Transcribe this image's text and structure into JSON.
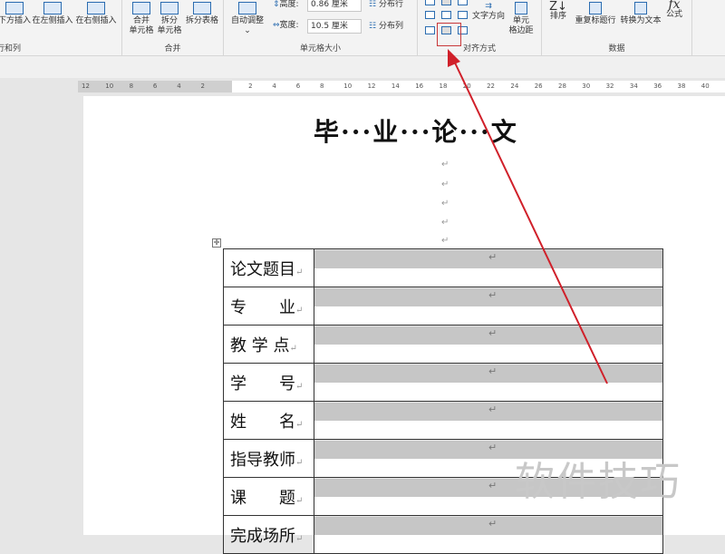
{
  "ribbon": {
    "rows_cols": {
      "buttons": [
        "下方插入",
        "在左侧插入",
        "在右侧插入"
      ],
      "label": "行和列"
    },
    "merge": {
      "buttons": [
        "合并\n单元格",
        "拆分\n单元格",
        "拆分表格"
      ],
      "label": "合并"
    },
    "cell_size": {
      "autofit": "自动调整",
      "height_label": "高度:",
      "height_value": "0.86 厘米",
      "width_label": "宽度:",
      "width_value": "10.5 厘米",
      "dist_rows": "分布行",
      "dist_cols": "分布列",
      "label": "单元格大小"
    },
    "alignment": {
      "text_direction": "文字方向",
      "cell_margins": "单元\n格边距",
      "label": "对齐方式"
    },
    "data": {
      "buttons": [
        "排序",
        "重复标题行",
        "转换为文本",
        "公式"
      ],
      "label": "数据"
    }
  },
  "ruler": [
    "12",
    "10",
    "8",
    "6",
    "4",
    "2",
    "",
    "2",
    "4",
    "6",
    "8",
    "10",
    "12",
    "14",
    "16",
    "18",
    "20",
    "22",
    "24",
    "26",
    "28",
    "30",
    "32",
    "34",
    "36",
    "38",
    "40"
  ],
  "document": {
    "title": "毕···业···论···文",
    "rows": [
      {
        "label": "论文题目",
        "wide": true
      },
      {
        "label": "专　　业",
        "wide": true
      },
      {
        "label": "教 学 点",
        "wide": true
      },
      {
        "label": "学　　号",
        "wide": true
      },
      {
        "label": "姓　　名",
        "wide": true
      },
      {
        "label": "指导教师",
        "wide": false
      },
      {
        "label": "课　　题",
        "wide": false
      },
      {
        "label": "完成场所",
        "wide": false
      }
    ],
    "para_mark": "↵"
  },
  "watermark": "软件技巧",
  "colors": {
    "arrow": "#d0202a",
    "highlight_box": "#c8383a"
  }
}
